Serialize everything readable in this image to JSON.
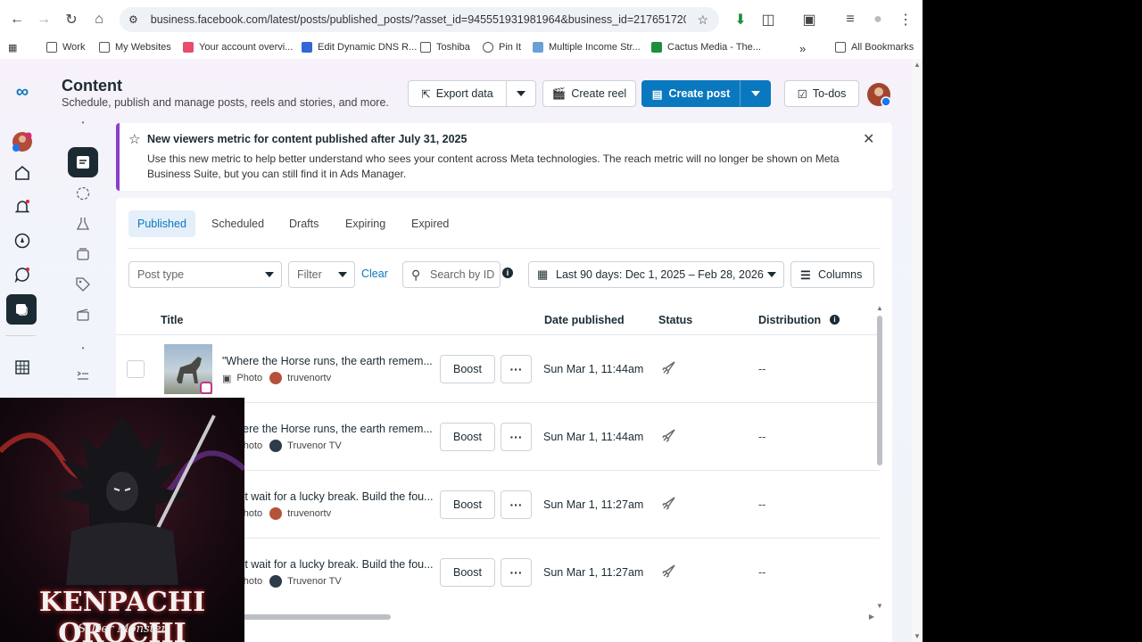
{
  "browser": {
    "url": "business.facebook.com/latest/posts/published_posts/?asset_id=945551931981964&business_id=217651720621...",
    "bookmarks": [
      "Work",
      "My Websites",
      "Your account overvi...",
      "Edit Dynamic DNS R...",
      "Toshiba",
      "Pin It",
      "Multiple Income Str...",
      "Cactus Media - The..."
    ],
    "more_bookmarks": "»",
    "all_bookmarks": "All Bookmarks"
  },
  "header": {
    "title": "Content",
    "subtitle": "Schedule, publish and manage posts, reels and stories, and more.",
    "export_label": "Export data",
    "create_reel_label": "Create reel",
    "create_post_label": "Create post",
    "todos_label": "To-dos"
  },
  "banner": {
    "title": "New viewers metric for content published after July 31, 2025",
    "body": "Use this new metric to help better understand who sees your content across Meta technologies. The reach metric will no longer be shown on Meta Business Suite, but you can still find it in Ads Manager."
  },
  "tabs": [
    "Published",
    "Scheduled",
    "Drafts",
    "Expiring",
    "Expired"
  ],
  "filters": {
    "post_type_placeholder": "Post type",
    "filter_label": "Filter",
    "clear_label": "Clear",
    "search_placeholder": "Search by ID",
    "date_range": "Last 90 days: Dec 1, 2025 – Feb 28, 2026",
    "columns_label": "Columns"
  },
  "table": {
    "headers": [
      "Title",
      "Date published",
      "Status",
      "Distribution"
    ],
    "rows": [
      {
        "title": "\"Where the Horse runs, the earth remem...",
        "type": "Photo",
        "account": "truvenortv",
        "date": "Sun Mar 1, 11:44am",
        "distribution": "--",
        "boost": "Boost"
      },
      {
        "title": "\"Where the Horse runs, the earth remem...",
        "type": "Photo",
        "account": "Truvenor TV",
        "date": "Sun Mar 1, 11:44am",
        "distribution": "--",
        "boost": "Boost"
      },
      {
        "title": "Don't wait for a lucky break. Build the fou...",
        "type": "Photo",
        "account": "truvenortv",
        "date": "Sun Mar 1, 11:27am",
        "distribution": "--",
        "boost": "Boost"
      },
      {
        "title": "Don't wait for a lucky break. Build the fou...",
        "type": "Photo",
        "account": "Truvenor TV",
        "date": "Sun Mar 1, 11:27am",
        "distribution": "--",
        "boost": "Boost"
      }
    ]
  },
  "overlay": {
    "title": "KENPACHI OROCHI",
    "subtitle": "S-Tier Monster"
  },
  "colors": {
    "accent": "#0a78be",
    "banner_bar": "#8b3fc9"
  }
}
